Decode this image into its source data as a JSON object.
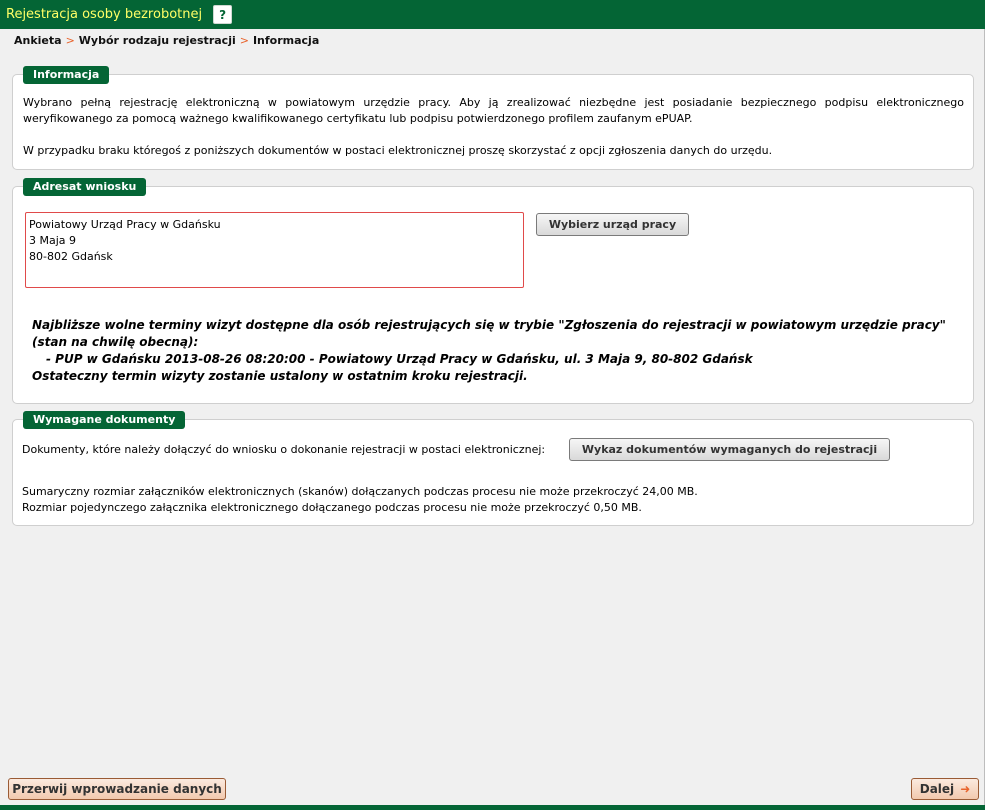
{
  "window": {
    "title": "Rejestracja osoby bezrobotnej",
    "help_label": "?"
  },
  "breadcrumb": {
    "items": [
      "Ankieta",
      "Wybór rodzaju rejestracji",
      "Informacja"
    ],
    "separator": ">"
  },
  "info": {
    "label": "Informacja",
    "paragraph1": "Wybrano pełną rejestrację elektroniczną w powiatowym urzędzie pracy. Aby ją zrealizować niezbędne jest posiadanie bezpiecznego podpisu elektronicznego weryfikowanego za pomocą ważnego kwalifikowanego certyfikatu lub podpisu potwierdzonego profilem zaufanym ePUAP.",
    "paragraph2": "W przypadku braku któregoś z poniższych dokumentów w postaci elektronicznej proszę skorzystać z opcji zgłoszenia danych do urzędu."
  },
  "recipient": {
    "label": "Adresat wniosku",
    "address": [
      "Powiatowy Urząd Pracy w Gdańsku",
      "3 Maja 9",
      "80-802 Gdańsk"
    ],
    "choose_button": "Wybierz urząd pracy",
    "terms_line1": "Najbliższe wolne terminy wizyt dostępne dla osób rejestrujących się w trybie \"Zgłoszenia do rejestracji w powiatowym urzędzie pracy\" (stan na chwilę obecną):",
    "terms_item": "- PUP w Gdańsku 2013-08-26 08:20:00 - Powiatowy Urząd Pracy w Gdańsku, ul. 3 Maja 9, 80-802 Gdańsk",
    "terms_line3": "Ostateczny termin wizyty zostanie ustalony w ostatnim kroku rejestracji."
  },
  "documents": {
    "label": "Wymagane dokumenty",
    "intro": "Dokumenty, które należy dołączyć do wniosku o dokonanie rejestracji w postaci elektronicznej:",
    "list_button": "Wykaz dokumentów wymaganych do rejestracji",
    "size_total": "Sumaryczny rozmiar załączników elektronicznych (skanów) dołączanych podczas procesu nie może przekroczyć 24,00 MB.",
    "size_single": "Rozmiar pojedynczego załącznika elektronicznego dołączanego podczas procesu nie może przekroczyć 0,50 MB."
  },
  "footer": {
    "cancel_button": "Przerwij wprowadzanie danych",
    "next_button": "Dalej",
    "next_icon": "arrow-right-icon"
  },
  "colors": {
    "primary_green": "#046535",
    "title_yellow": "#ffff66",
    "accent_orange": "#e8632c",
    "error_red": "#e04a4a"
  }
}
